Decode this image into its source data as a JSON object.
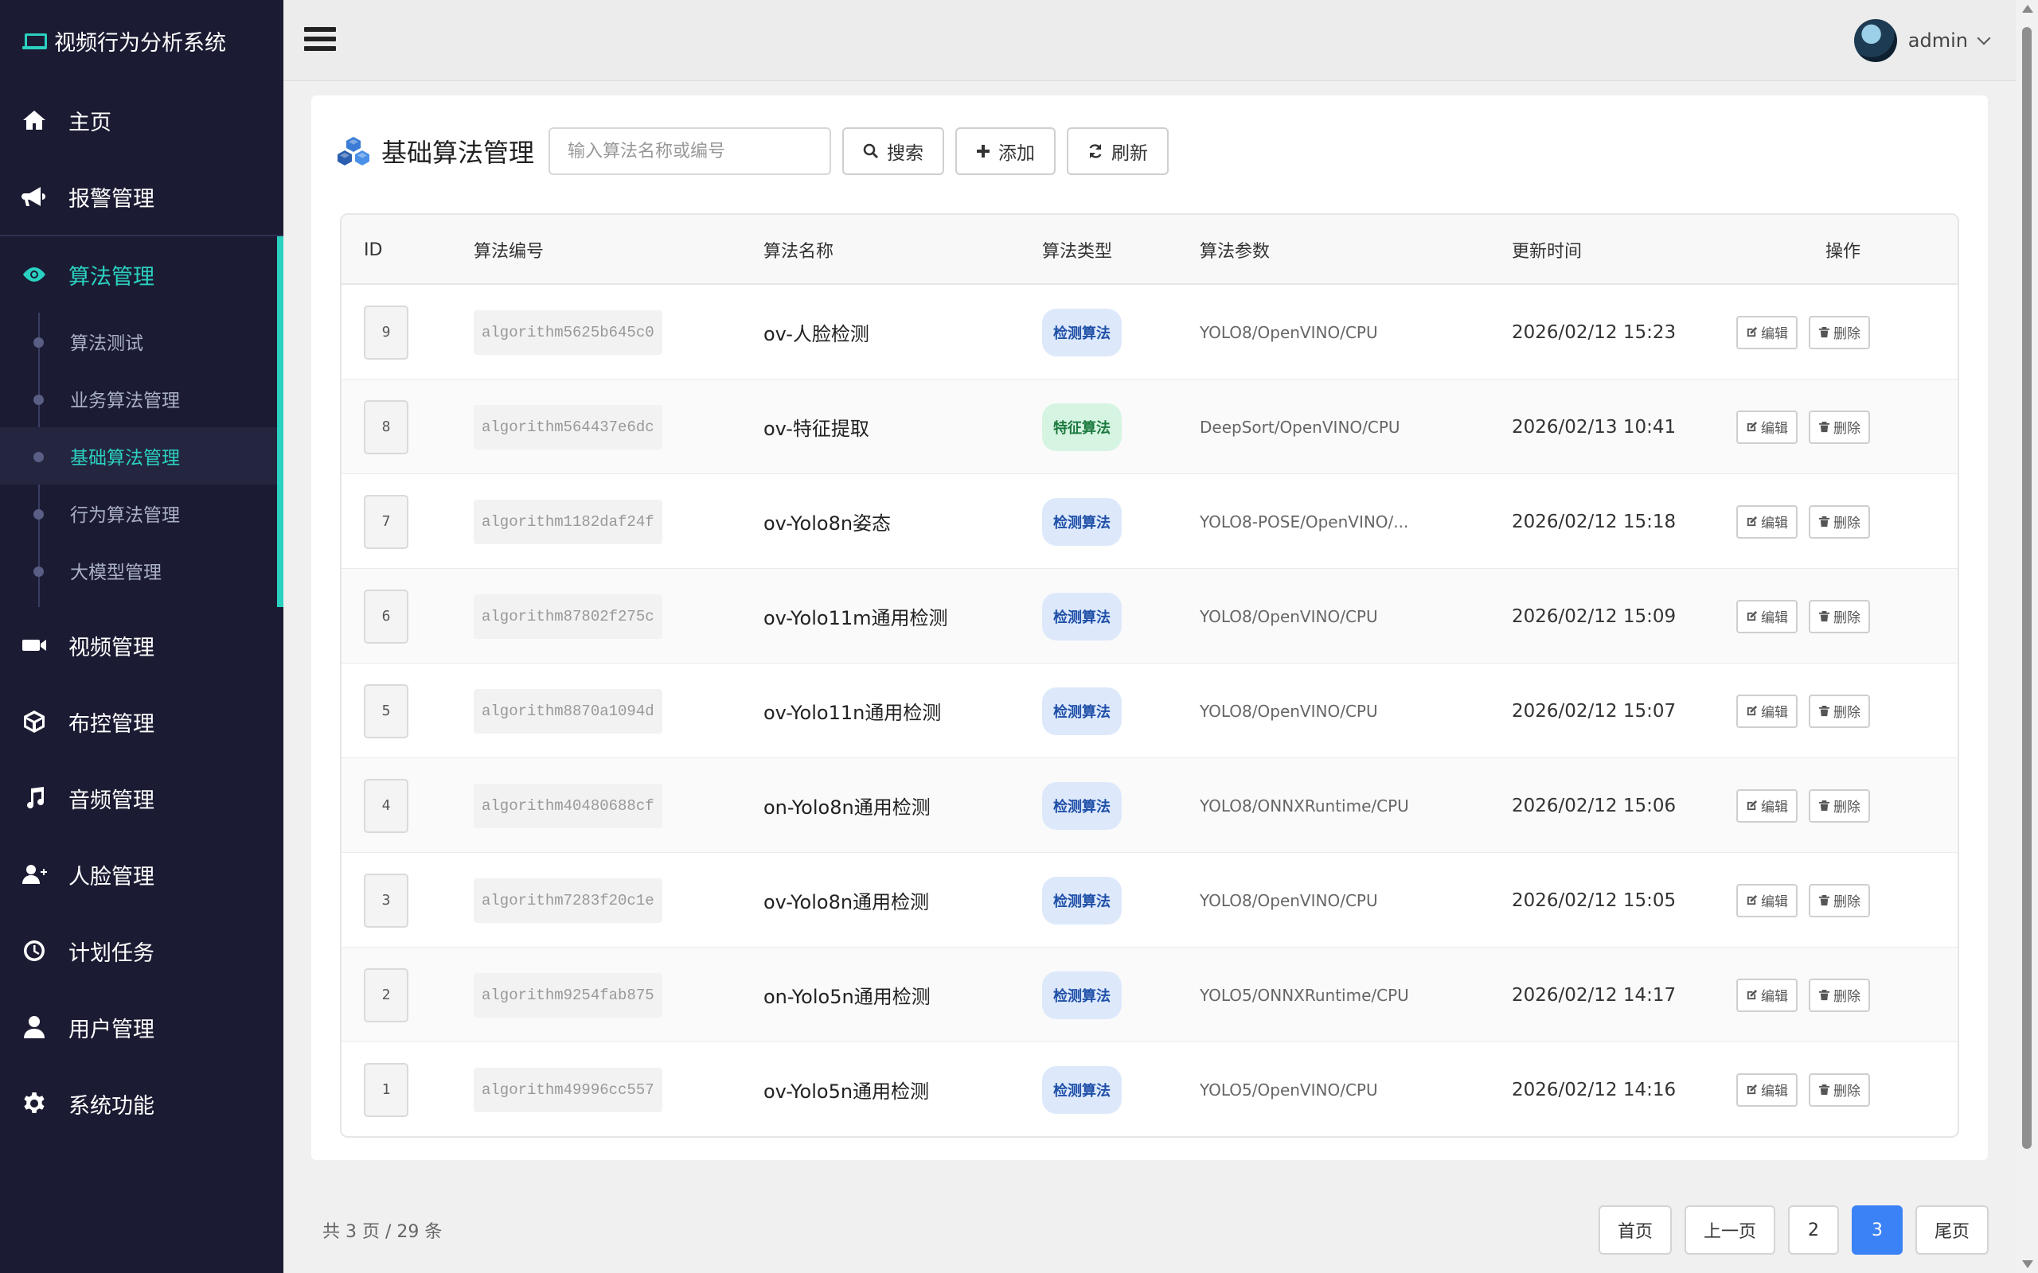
{
  "app": {
    "title": "视频行为分析系统"
  },
  "sidebar": {
    "items": [
      {
        "label": "主页",
        "icon": "home-icon"
      },
      {
        "label": "报警管理",
        "icon": "megaphone-icon"
      },
      {
        "label": "算法管理",
        "icon": "eye-icon"
      },
      {
        "label": "视频管理",
        "icon": "video-camera-icon"
      },
      {
        "label": "布控管理",
        "icon": "cube-icon"
      },
      {
        "label": "音频管理",
        "icon": "music-icon"
      },
      {
        "label": "人脸管理",
        "icon": "user-plus-icon"
      },
      {
        "label": "计划任务",
        "icon": "clock-icon"
      },
      {
        "label": "用户管理",
        "icon": "user-icon"
      },
      {
        "label": "系统功能",
        "icon": "gear-icon"
      }
    ],
    "sub_items": [
      {
        "label": "算法测试"
      },
      {
        "label": "业务算法管理"
      },
      {
        "label": "基础算法管理"
      },
      {
        "label": "行为算法管理"
      },
      {
        "label": "大模型管理"
      }
    ],
    "accent_color": "#2bd1c0"
  },
  "topbar": {
    "username": "admin"
  },
  "page": {
    "title": "基础算法管理",
    "search_placeholder": "输入算法名称或编号",
    "buttons": {
      "search": "搜索",
      "add": "添加",
      "refresh": "刷新"
    }
  },
  "table": {
    "headers": {
      "id": "ID",
      "code": "算法编号",
      "name": "算法名称",
      "type": "算法类型",
      "params": "算法参数",
      "updated": "更新时间",
      "ops": "操作"
    },
    "edit_label": "编辑",
    "delete_label": "删除",
    "rows": [
      {
        "id": "9",
        "code": "algorithm5625b645c0",
        "name": "ov-人脸检测",
        "type": "检测算法",
        "params": "YOLO8/OpenVINO/CPU",
        "updated": "2026/02/12 15:23"
      },
      {
        "id": "8",
        "code": "algorithm564437e6dc",
        "name": "ov-特征提取",
        "type": "特征算法",
        "params": "DeepSort/OpenVINO/CPU",
        "updated": "2026/02/13 10:41"
      },
      {
        "id": "7",
        "code": "algorithm1182daf24f",
        "name": "ov-Yolo8n姿态",
        "type": "检测算法",
        "params": "YOLO8-POSE/OpenVINO/...",
        "updated": "2026/02/12 15:18"
      },
      {
        "id": "6",
        "code": "algorithm87802f275c",
        "name": "ov-Yolo11m通用检测",
        "type": "检测算法",
        "params": "YOLO8/OpenVINO/CPU",
        "updated": "2026/02/12 15:09"
      },
      {
        "id": "5",
        "code": "algorithm8870a1094d",
        "name": "ov-Yolo11n通用检测",
        "type": "检测算法",
        "params": "YOLO8/OpenVINO/CPU",
        "updated": "2026/02/12 15:07"
      },
      {
        "id": "4",
        "code": "algorithm40480688cf",
        "name": "on-Yolo8n通用检测",
        "type": "检测算法",
        "params": "YOLO8/ONNXRuntime/CPU",
        "updated": "2026/02/12 15:06"
      },
      {
        "id": "3",
        "code": "algorithm7283f20c1e",
        "name": "ov-Yolo8n通用检测",
        "type": "检测算法",
        "params": "YOLO8/OpenVINO/CPU",
        "updated": "2026/02/12 15:05"
      },
      {
        "id": "2",
        "code": "algorithm9254fab875",
        "name": "on-Yolo5n通用检测",
        "type": "检测算法",
        "params": "YOLO5/ONNXRuntime/CPU",
        "updated": "2026/02/12 14:17"
      },
      {
        "id": "1",
        "code": "algorithm49996cc557",
        "name": "ov-Yolo5n通用检测",
        "type": "检测算法",
        "params": "YOLO5/OpenVINO/CPU",
        "updated": "2026/02/12 14:16"
      }
    ]
  },
  "pagination": {
    "summary": "共 3 页 / 29 条",
    "first": "首页",
    "prev": "上一页",
    "pages": [
      "2",
      "3"
    ],
    "current": "3",
    "last": "尾页"
  },
  "colors": {
    "detect_badge_bg": "#dde9fb",
    "feature_badge_bg": "#d6f4e2",
    "current_page": "#3b82f6"
  }
}
